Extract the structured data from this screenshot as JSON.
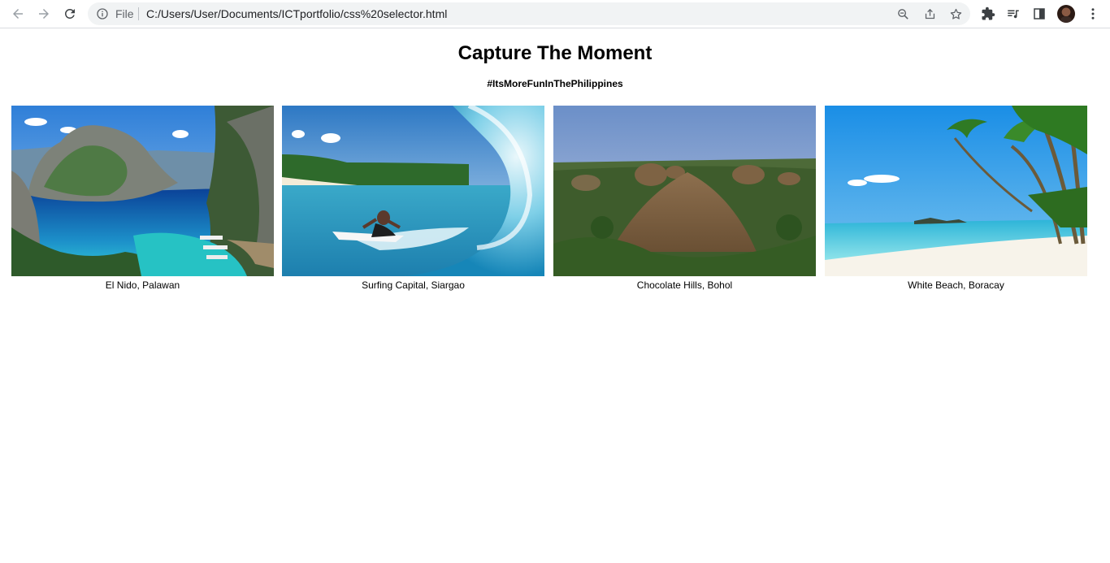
{
  "browser": {
    "file_label": "File",
    "url": "C:/Users/User/Documents/ICTportfolio/css%20selector.html",
    "icons": [
      "back-arrow-icon",
      "forward-arrow-icon",
      "reload-icon",
      "info-icon",
      "zoom-icon",
      "share-icon",
      "bookmark-star-icon",
      "extensions-puzzle-icon",
      "media-queue-icon",
      "side-panel-icon",
      "profile-avatar",
      "more-vert-icon"
    ]
  },
  "page": {
    "title": "Capture The Moment",
    "subtitle": "#ItsMoreFunInThePhilippines"
  },
  "gallery": [
    {
      "caption": "El Nido, Palawan"
    },
    {
      "caption": "Surfing Capital, Siargao"
    },
    {
      "caption": "Chocolate Hills, Bohol"
    },
    {
      "caption": "White Beach, Boracay"
    }
  ]
}
